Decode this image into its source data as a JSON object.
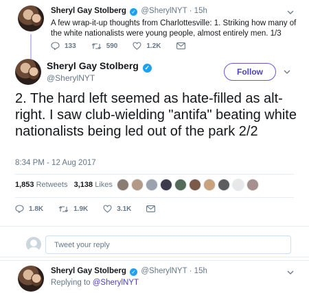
{
  "parent_tweet": {
    "name": "Sheryl Gay Stolberg",
    "handle": "@SherylNYT",
    "age": "15h",
    "text": "A few wrap-it-up thoughts from Charlottesville: 1. Striking how many of the white nationalists were young people, almost entirely men. 1/3",
    "replies": "133",
    "retweets": "590",
    "likes": "1.2K"
  },
  "main_tweet": {
    "name": "Sheryl Gay Stolberg",
    "handle": "@SherylNYT",
    "follow_label": "Follow",
    "text": "2. The hard left seemed as hate-filled as alt-right. I saw club-wielding \"antifa\" beating white nationalists being led out of the park 2/2",
    "timestamp": "8:34 PM - 12 Aug 2017",
    "retweet_count": "1,853",
    "retweet_label": "Retweets",
    "like_count": "3,138",
    "like_label": "Likes",
    "replies": "1.8K",
    "retweets": "1.9K",
    "likes": "3.1K"
  },
  "reply_box": {
    "placeholder": "Tweet your reply"
  },
  "next_tweet": {
    "name": "Sheryl Gay Stolberg",
    "handle": "@SherylNYT",
    "age": "15h",
    "replying_prefix": "Replying to",
    "replying_to": "@SherylNYT"
  },
  "colors": {
    "accent": "#4a3fc4",
    "verified": "#1da1f2",
    "muted": "#657786",
    "liker_avatars": [
      "#8a7d74",
      "#b39a86",
      "#9aa3ad",
      "#3b3b4a",
      "#556b5a",
      "#7a5a48",
      "#c9a27e",
      "#5d5d5d",
      "#e8e8e8",
      "#a58f8f"
    ]
  }
}
